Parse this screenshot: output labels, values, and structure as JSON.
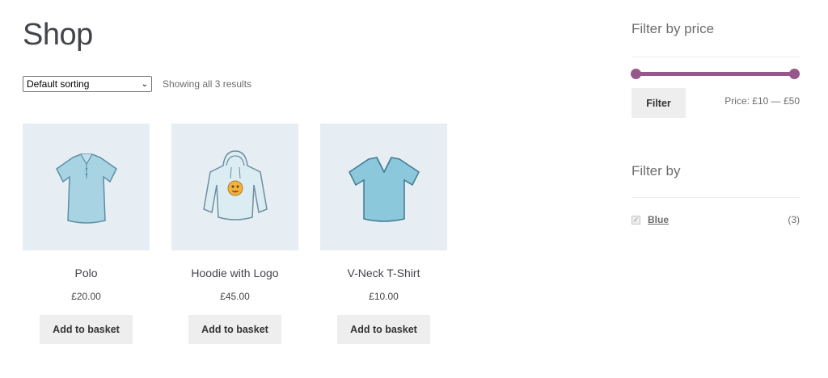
{
  "page": {
    "title": "Shop"
  },
  "toolbar": {
    "sorting_selected": "Default sorting",
    "sorting_chevron": "⌄",
    "result_count": "Showing all 3 results"
  },
  "products": [
    {
      "name": "Polo",
      "price": "£20.00",
      "button": "Add to basket",
      "image": "polo-shirt-icon"
    },
    {
      "name": "Hoodie with Logo",
      "price": "£45.00",
      "button": "Add to basket",
      "image": "hoodie-icon"
    },
    {
      "name": "V-Neck T-Shirt",
      "price": "£10.00",
      "button": "Add to basket",
      "image": "vneck-tshirt-icon"
    }
  ],
  "sidebar": {
    "price_widget": {
      "title": "Filter by price",
      "button": "Filter",
      "range_label": "Price: £10 — £50",
      "min": 10,
      "max": 50,
      "selected_min_fraction": 0,
      "selected_max_fraction": 1
    },
    "attribute_widget": {
      "title": "Filter by",
      "items": [
        {
          "label": "Blue",
          "count": "(3)",
          "checked": true
        }
      ]
    }
  },
  "colors": {
    "accent": "#96588a",
    "product_bg": "#e7eef3",
    "button_bg": "#eeeeee",
    "shirt_blue": "#a7d3e3"
  }
}
